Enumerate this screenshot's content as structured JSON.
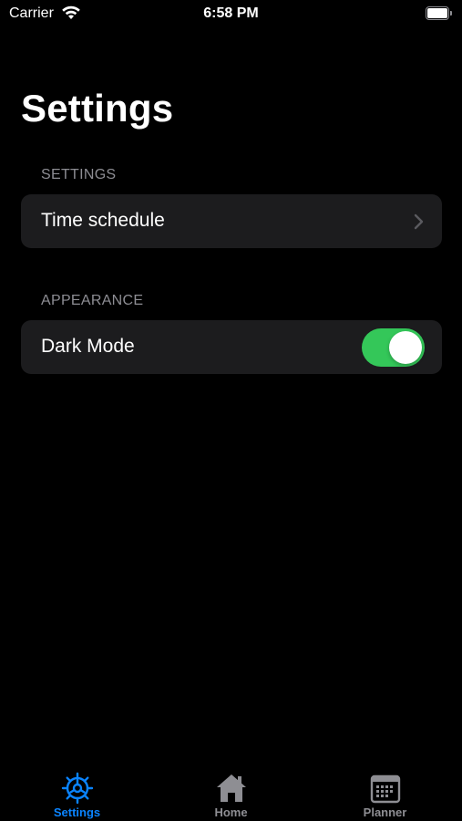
{
  "status_bar": {
    "carrier": "Carrier",
    "time": "6:58 PM"
  },
  "page": {
    "title": "Settings"
  },
  "sections": [
    {
      "header": "SETTINGS",
      "rows": [
        {
          "label": "Time schedule",
          "accessory": "chevron-right-icon"
        }
      ]
    },
    {
      "header": "APPEARANCE",
      "rows": [
        {
          "label": "Dark Mode",
          "accessory": "toggle",
          "toggle_on": true
        }
      ]
    }
  ],
  "tab_bar": {
    "tabs": [
      {
        "label": "Settings",
        "icon": "settings-gear-icon",
        "active": true
      },
      {
        "label": "Home",
        "icon": "house-icon",
        "active": false
      },
      {
        "label": "Planner",
        "icon": "calendar-icon",
        "active": false
      }
    ]
  },
  "colors": {
    "background": "#000000",
    "group_background": "#1c1c1e",
    "section_header": "#8d8d93",
    "toggle_on": "#34c759",
    "tab_active": "#0a84ff",
    "tab_inactive": "#8e8e93",
    "chevron": "#5a5a5f"
  }
}
